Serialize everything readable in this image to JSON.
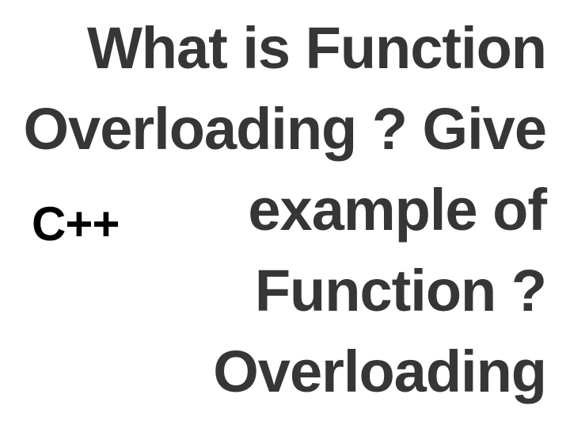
{
  "title": "What is Function Overloading ? Give example of Function ?Overloading",
  "label": "C++"
}
